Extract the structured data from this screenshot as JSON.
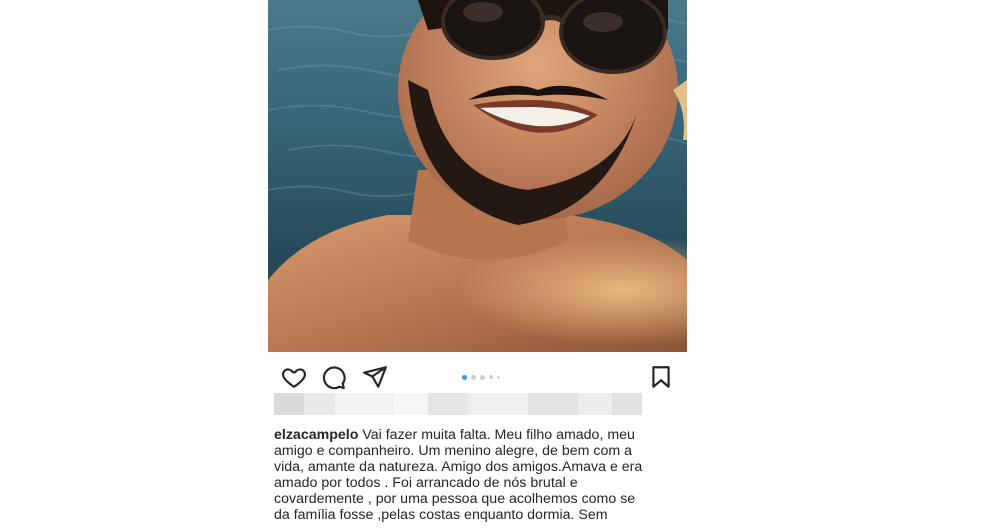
{
  "post": {
    "photo": {
      "icon": "selfie-photo"
    },
    "actions": {
      "like_icon": "heart-icon",
      "comment_icon": "comment-icon",
      "share_icon": "send-icon",
      "save_icon": "bookmark-icon"
    },
    "carousel": {
      "count": 5,
      "active_index": 0
    },
    "caption": {
      "username": "elzacampelo",
      "lines": [
        "Vai fazer muita falta. Meu filho amado, meu",
        "amigo e companheiro. Um menino alegre, de bem com a",
        "vida, amante da natureza. Amigo dos amigos.Amava e era",
        "amado por todos . Foi arrancado de nós brutal e",
        "covardemente , por uma pessoa que acolhemos como se",
        "da família fosse ,pelas costas enquanto dormia. Sem"
      ]
    }
  },
  "colors": {
    "accent": "#3897f0",
    "text": "#262626",
    "dot_inactive": "#cfcfcf"
  }
}
